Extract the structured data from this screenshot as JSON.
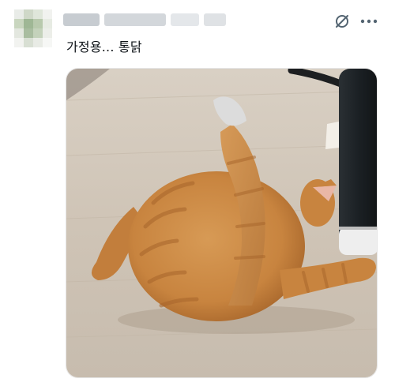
{
  "post": {
    "text": "가정용... 통닭",
    "author_redacted": true
  },
  "icons": {
    "grok": "grok-icon",
    "more": "more-options-icon"
  },
  "media": {
    "type": "photo",
    "subject": "cat"
  },
  "colors": {
    "text": "#0f1419",
    "icon": "#536471",
    "border": "#e6e6e6"
  }
}
